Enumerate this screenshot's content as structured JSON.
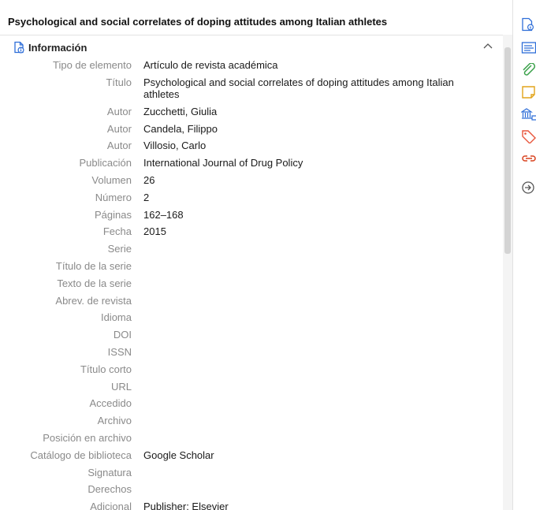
{
  "header": {
    "title": "Psychological and social correlates of doping attitudes among Italian athletes"
  },
  "section": {
    "title": "Información"
  },
  "fields": [
    {
      "label": "Tipo de elemento",
      "value": "Artículo de revista académica"
    },
    {
      "label": "Título",
      "value": "Psychological and social correlates of doping attitudes among Italian athletes"
    },
    {
      "label": "Autor",
      "value": "Zucchetti, Giulia"
    },
    {
      "label": "Autor",
      "value": "Candela, Filippo"
    },
    {
      "label": "Autor",
      "value": "Villosio, Carlo"
    },
    {
      "label": "Publicación",
      "value": "International Journal of Drug Policy"
    },
    {
      "label": "Volumen",
      "value": "26"
    },
    {
      "label": "Número",
      "value": "2"
    },
    {
      "label": "Páginas",
      "value": "162–168"
    },
    {
      "label": "Fecha",
      "value": "2015"
    },
    {
      "label": "Serie",
      "value": ""
    },
    {
      "label": "Título de la serie",
      "value": ""
    },
    {
      "label": "Texto de la serie",
      "value": ""
    },
    {
      "label": "Abrev. de revista",
      "value": ""
    },
    {
      "label": "Idioma",
      "value": ""
    },
    {
      "label": "DOI",
      "value": ""
    },
    {
      "label": "ISSN",
      "value": ""
    },
    {
      "label": "Título corto",
      "value": ""
    },
    {
      "label": "URL",
      "value": ""
    },
    {
      "label": "Accedido",
      "value": ""
    },
    {
      "label": "Archivo",
      "value": ""
    },
    {
      "label": "Posición en archivo",
      "value": ""
    },
    {
      "label": "Catálogo de biblioteca",
      "value": "Google Scholar"
    },
    {
      "label": "Signatura",
      "value": ""
    },
    {
      "label": "Derechos",
      "value": ""
    },
    {
      "label": "Adicional",
      "value": "Publisher: Elsevier"
    }
  ],
  "sidebar": {
    "icons": [
      "info-icon",
      "abstract-icon",
      "attachment-icon",
      "notes-icon",
      "libraries-icon",
      "tags-icon",
      "related-icon",
      "locate-icon"
    ]
  },
  "colors": {
    "accent": "#2e6ed8",
    "attachment": "#3aa14a",
    "notes": "#e2a41a",
    "tags": "#e8553b",
    "related": "#d9421f"
  }
}
